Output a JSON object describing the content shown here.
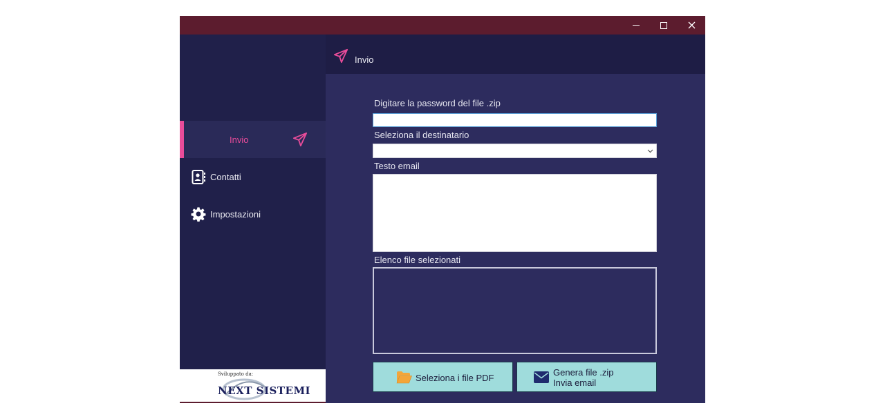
{
  "window": {
    "controls": {
      "minimize_icon": "minimize-icon",
      "maximize_icon": "maximize-icon",
      "close_icon": "close-icon"
    }
  },
  "sidebar": {
    "items": [
      {
        "label": "Invio",
        "icon": "paper-plane-icon",
        "active": true
      },
      {
        "label": "Contatti",
        "icon": "contacts-icon",
        "active": false
      },
      {
        "label": "Impostazioni",
        "icon": "gear-icon",
        "active": false
      }
    ],
    "footer": {
      "developed_by": "Sviluppato da:",
      "brand": "NEXT SISTEMI"
    }
  },
  "header": {
    "title": "Invio",
    "icon": "paper-plane-icon"
  },
  "form": {
    "password_label": "Digitare la password del file .zip",
    "password_value": "",
    "recipient_label": "Seleziona il destinatario",
    "recipient_value": "",
    "email_text_label": "Testo email",
    "email_text_value": "",
    "files_label": "Elenco file selezionati",
    "files": []
  },
  "buttons": {
    "select_pdf": "Seleziona i file PDF",
    "generate_line1": "Genera file .zip",
    "generate_line2": "Invia email"
  },
  "colors": {
    "titlebar": "#5c1c2e",
    "sidebar": "#20204a",
    "content": "#2d2c5e",
    "header": "#1e1d45",
    "accent": "#e94c9a",
    "button": "#9fdcdc",
    "folder": "#f3a53a"
  }
}
